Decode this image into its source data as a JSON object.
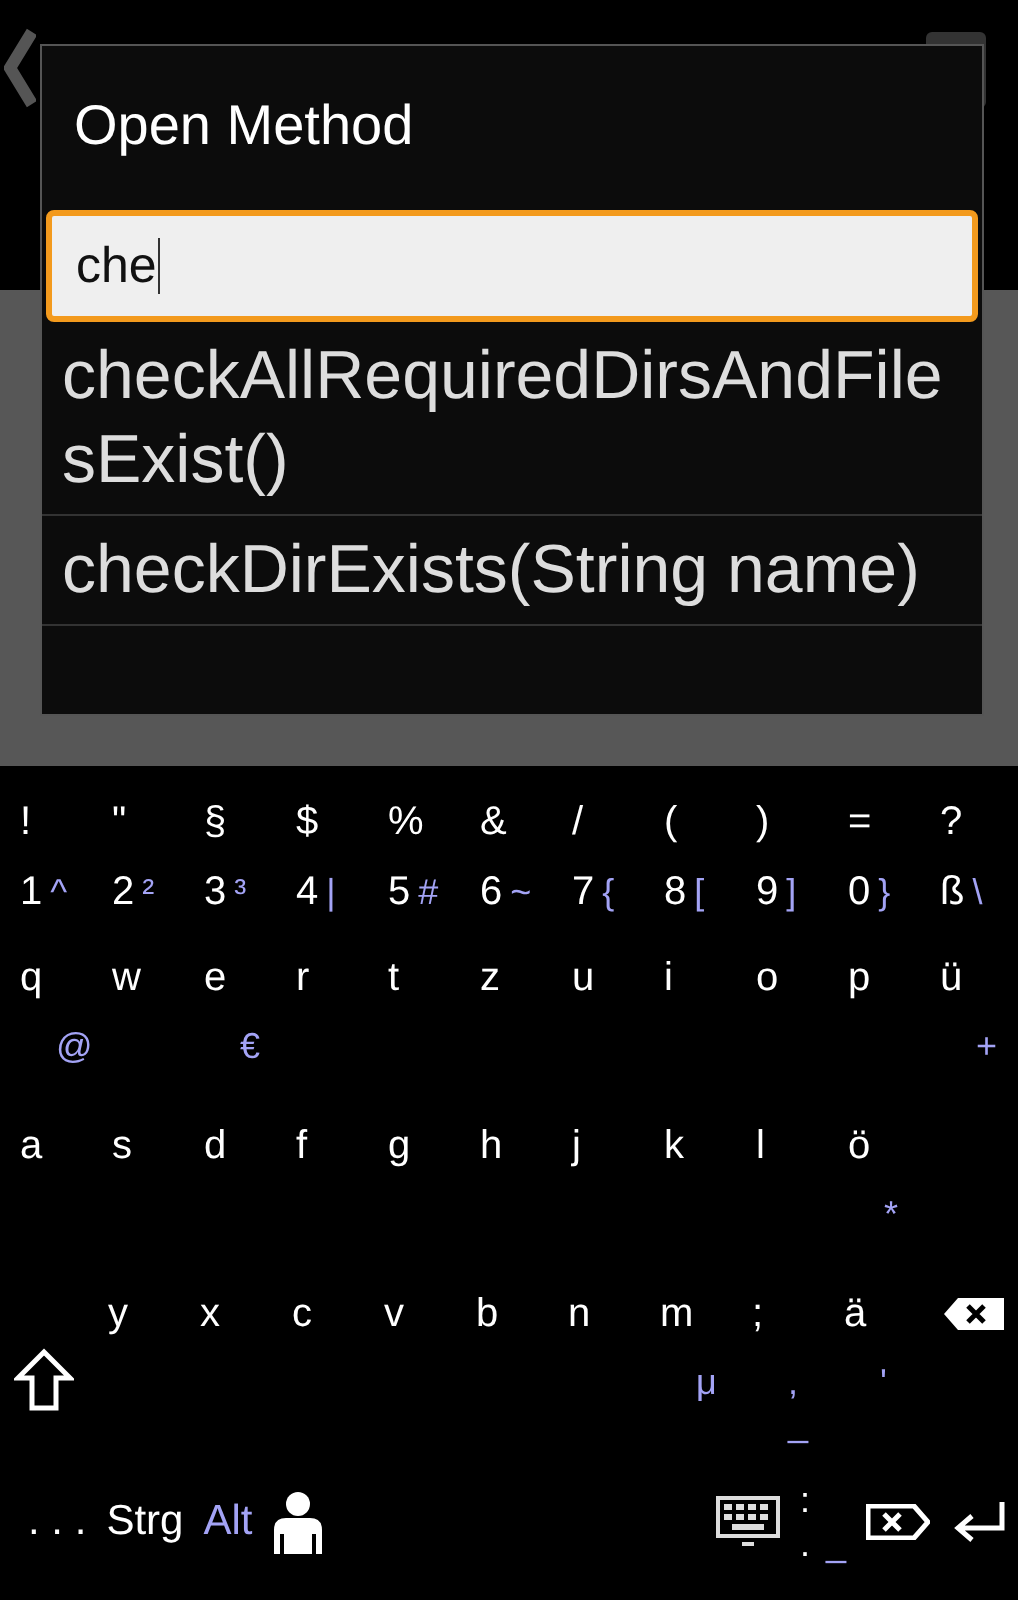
{
  "dialog": {
    "title": "Open Method",
    "search": {
      "value": "che"
    },
    "results": [
      {
        "label": "checkAllRequiredDirsAndFilesExist()"
      },
      {
        "label": "checkDirExists(String name)"
      }
    ]
  },
  "keyboard": {
    "rows": [
      {
        "kind": "inline",
        "keys": [
          {
            "main": "!"
          },
          {
            "main": "\""
          },
          {
            "main": "§"
          },
          {
            "main": "$"
          },
          {
            "main": "%"
          },
          {
            "main": "&"
          },
          {
            "main": "/"
          },
          {
            "main": "("
          },
          {
            "main": ")"
          },
          {
            "main": "="
          },
          {
            "main": "?"
          }
        ]
      },
      {
        "kind": "inline",
        "keys": [
          {
            "main": "1",
            "alt": "^"
          },
          {
            "main": "2",
            "alt": "²"
          },
          {
            "main": "3",
            "alt": "³"
          },
          {
            "main": "4",
            "alt": "|"
          },
          {
            "main": "5",
            "alt": "#"
          },
          {
            "main": "6",
            "alt": "~"
          },
          {
            "main": "7",
            "alt": "{"
          },
          {
            "main": "8",
            "alt": "["
          },
          {
            "main": "9",
            "alt": "]"
          },
          {
            "main": "0",
            "alt": "}"
          },
          {
            "main": "ß",
            "alt": "\\"
          }
        ]
      },
      {
        "kind": "stacked",
        "keys": [
          {
            "main": "q",
            "alt": "@"
          },
          {
            "main": "w"
          },
          {
            "main": "e",
            "alt": "€"
          },
          {
            "main": "r"
          },
          {
            "main": "t"
          },
          {
            "main": "z"
          },
          {
            "main": "u"
          },
          {
            "main": "i"
          },
          {
            "main": "o"
          },
          {
            "main": "p"
          },
          {
            "main": "ü",
            "alt": "+"
          }
        ]
      },
      {
        "kind": "stacked",
        "keys": [
          {
            "main": "a"
          },
          {
            "main": "s"
          },
          {
            "main": "d"
          },
          {
            "main": "f"
          },
          {
            "main": "g"
          },
          {
            "main": "h"
          },
          {
            "main": "j"
          },
          {
            "main": "k"
          },
          {
            "main": "l"
          },
          {
            "main": "ö",
            "alt": "*"
          }
        ]
      },
      {
        "kind": "stacked",
        "keys": [
          {
            "kind": "shift"
          },
          {
            "kind": "char",
            "main": "y"
          },
          {
            "kind": "char",
            "main": "x"
          },
          {
            "kind": "char",
            "main": "c"
          },
          {
            "kind": "char",
            "main": "v"
          },
          {
            "kind": "char",
            "main": "b"
          },
          {
            "kind": "char",
            "main": "n"
          },
          {
            "kind": "char",
            "main": "m",
            "alt": "μ"
          },
          {
            "kind": "char",
            "main": ";",
            "alt": ", _"
          },
          {
            "kind": "char",
            "main": "ä",
            "alt": "'"
          },
          {
            "kind": "backspace"
          }
        ]
      }
    ],
    "bottom_row": [
      {
        "kind": "text",
        "label": ". . ."
      },
      {
        "kind": "text",
        "label": "Strg"
      },
      {
        "kind": "modifier",
        "label": "Alt"
      },
      {
        "kind": "person"
      },
      {
        "kind": "spacer"
      },
      {
        "kind": "keyboard"
      },
      {
        "kind": "punct",
        "main": ":",
        "sub": ".",
        "alt": "_"
      },
      {
        "kind": "delete"
      },
      {
        "kind": "enter"
      }
    ]
  }
}
